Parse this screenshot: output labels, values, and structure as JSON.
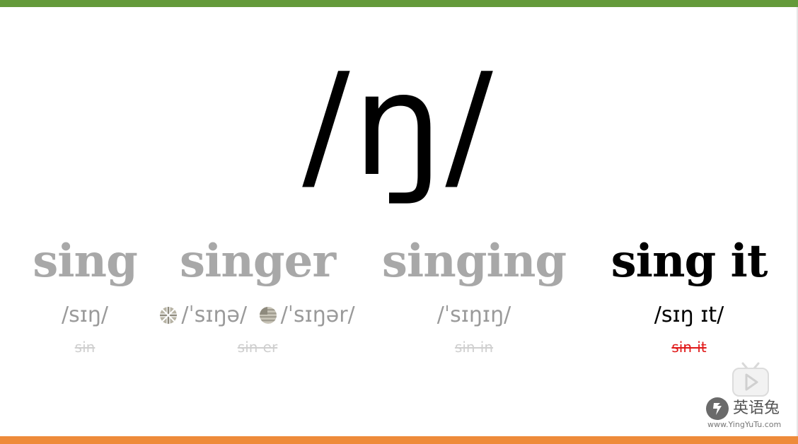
{
  "phoneme": "/ŋ/",
  "words": [
    {
      "word": "sing",
      "ipa": "/sɪŋ/",
      "hint": "sin",
      "active": false
    },
    {
      "word": "singer",
      "ipa_uk": "/ˈsɪŋə/",
      "ipa_us": "/ˈsɪŋər/",
      "hint": "sin-er",
      "active": false,
      "uk_flag_icon": "uk-flag-icon",
      "us_flag_icon": "us-flag-icon"
    },
    {
      "word": "singing",
      "ipa": "/ˈsɪŋɪŋ/",
      "hint": "sin-in",
      "active": false
    },
    {
      "word": "sing it",
      "ipa": "/sɪŋ ɪt/",
      "hint": "sin-it",
      "active": true
    }
  ],
  "brand": {
    "name": "英语兔",
    "url": "www.YingYuTu.com",
    "play_icon": "bilibili-play-icon",
    "logo_icon": "rabbit-logo-icon"
  },
  "colors": {
    "top_bar": "#649a3a",
    "bottom_bar": "#ee8b3a",
    "inactive_text": "#a8a8a8",
    "active_text": "#000000",
    "active_hint": "#e01818"
  }
}
